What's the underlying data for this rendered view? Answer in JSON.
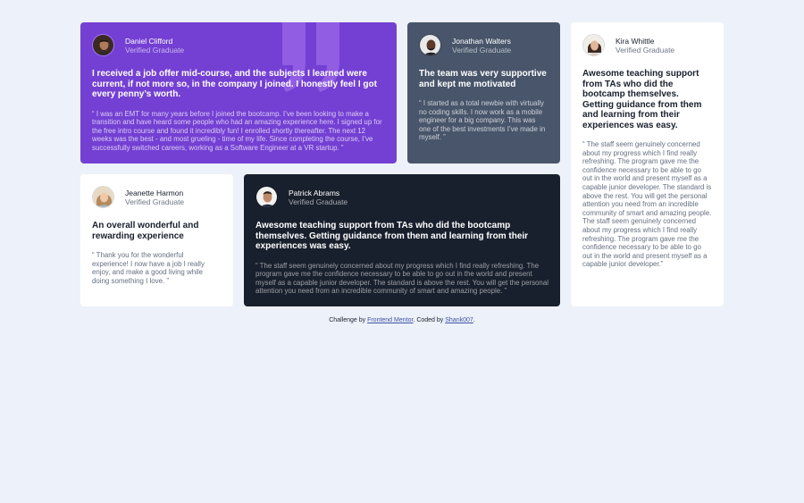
{
  "colors": {
    "page_bg": "#edf1f9",
    "moderate_violet": "#7440d3",
    "grayish_blue": "#48556a",
    "blackish_blue": "#19202d",
    "white": "#ffffff"
  },
  "testimonials": [
    {
      "name": "Daniel Clifford",
      "status": "Verified Graduate",
      "headline": "I received a job offer mid-course, and the subjects I learned were current, if not more so, in the company I joined. I honestly feel I got every penny’s worth.",
      "body": "“ I was an EMT for many years before I joined the bootcamp. I’ve been looking to make a transition and have heard some people who had an amazing experience here. I signed up for the free intro course and found it incredibly fun! I enrolled shortly thereafter. The next 12 weeks was the best - and most grueling - time of my life. Since completing the course, I’ve successfully switched careers, working as a Software Engineer at a VR startup. ”",
      "avatar_icon": "avatar-daniel-icon"
    },
    {
      "name": "Jonathan Walters",
      "status": "Verified Graduate",
      "headline": "The team was very supportive and kept me motivated",
      "body": "“ I started as a total newbie with virtually no coding skills. I now work as a mobile engineer for a big company. This was one of the best investments I’ve made in myself. ”",
      "avatar_icon": "avatar-jonathan-icon"
    },
    {
      "name": "Kira Whittle",
      "status": "Verified Graduate",
      "headline": "Awesome teaching support from TAs who did the bootcamp themselves. Getting guidance from them and learning from their experiences was easy.",
      "body": "“ The staff seem genuinely concerned about my progress which I find really refreshing. The program gave me the confidence necessary to be able to go out in the world and present myself as a capable junior developer. The standard is above the rest. You will get the personal attention you need from an incredible community of smart and amazing people. The staff seem genuinely concerned about my progress which I find really refreshing. The program gave me the confidence necessary to be able to go out in the world and present myself as a capable junior developer.”",
      "avatar_icon": "avatar-kira-icon"
    },
    {
      "name": "Jeanette Harmon",
      "status": "Verified Graduate",
      "headline": "An overall wonderful and rewarding experience",
      "body": "“ Thank you for the wonderful experience! I now have a job I really enjoy, and make a good living while doing something I love. ”",
      "avatar_icon": "avatar-jeanette-icon"
    },
    {
      "name": "Patrick Abrams",
      "status": "Verified Graduate",
      "headline": "Awesome teaching support from TAs who did the bootcamp themselves. Getting guidance from them and learning from their experiences was easy.",
      "body": "“ The staff seem genuinely concerned about my progress which I find really refreshing. The program gave me the confidence necessary to be able to go out in the world and present myself as a capable junior developer. The standard is above the rest. You will get the personal attention you need from an incredible community of smart and amazing people. ”",
      "avatar_icon": "avatar-patrick-icon"
    }
  ],
  "footer": {
    "prefix": "Challenge by ",
    "link1": "Frontend Mentor",
    "middle": ". Coded by ",
    "link2": "Shank007",
    "suffix": "."
  }
}
